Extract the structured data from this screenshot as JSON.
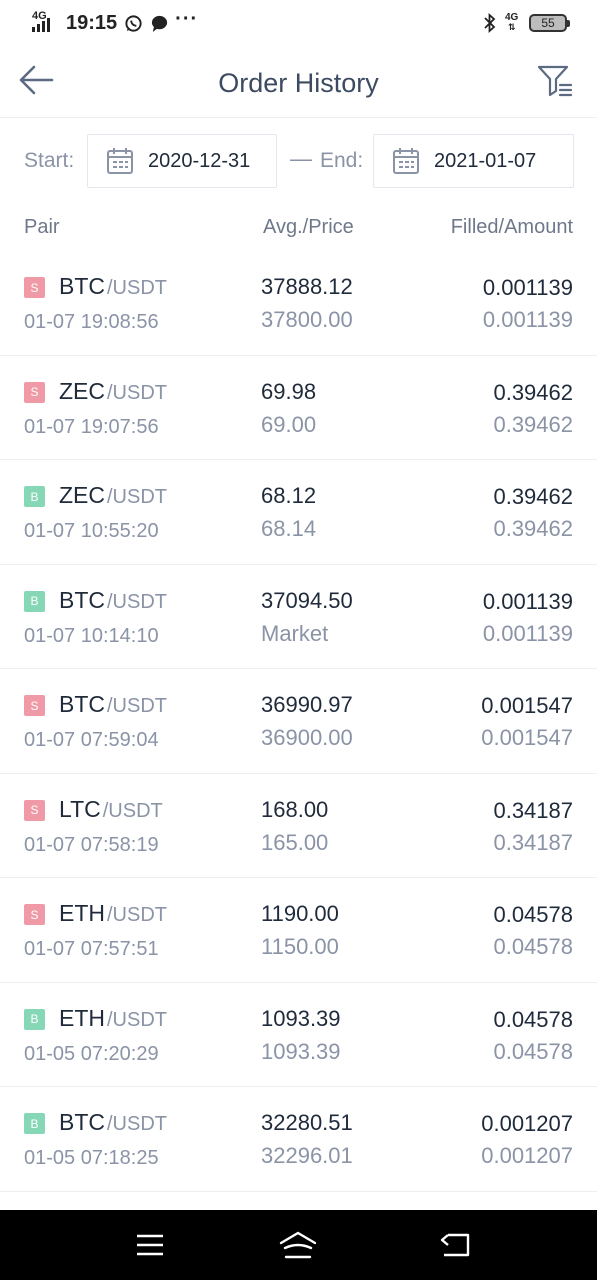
{
  "status_bar": {
    "network": "4G",
    "time": "19:15",
    "network_right": "4G",
    "battery": "55"
  },
  "header": {
    "title": "Order History"
  },
  "date_filter": {
    "start_label": "Start:",
    "start_value": "2020-12-31",
    "separator": "—",
    "end_label": "End:",
    "end_value": "2021-01-07"
  },
  "columns": {
    "pair": "Pair",
    "avg_price": "Avg./Price",
    "filled_amount": "Filled/Amount"
  },
  "orders": [
    {
      "side": "S",
      "base": "BTC",
      "quote": "/USDT",
      "time": "01-07 19:08:56",
      "avg": "37888.12",
      "price": "37800.00",
      "filled": "0.001139",
      "amount": "0.001139"
    },
    {
      "side": "S",
      "base": "ZEC",
      "quote": "/USDT",
      "time": "01-07 19:07:56",
      "avg": "69.98",
      "price": "69.00",
      "filled": "0.39462",
      "amount": "0.39462"
    },
    {
      "side": "B",
      "base": "ZEC",
      "quote": "/USDT",
      "time": "01-07 10:55:20",
      "avg": "68.12",
      "price": "68.14",
      "filled": "0.39462",
      "amount": "0.39462"
    },
    {
      "side": "B",
      "base": "BTC",
      "quote": "/USDT",
      "time": "01-07 10:14:10",
      "avg": "37094.50",
      "price": "Market",
      "filled": "0.001139",
      "amount": "0.001139"
    },
    {
      "side": "S",
      "base": "BTC",
      "quote": "/USDT",
      "time": "01-07 07:59:04",
      "avg": "36990.97",
      "price": "36900.00",
      "filled": "0.001547",
      "amount": "0.001547"
    },
    {
      "side": "S",
      "base": "LTC",
      "quote": "/USDT",
      "time": "01-07 07:58:19",
      "avg": "168.00",
      "price": "165.00",
      "filled": "0.34187",
      "amount": "0.34187"
    },
    {
      "side": "S",
      "base": "ETH",
      "quote": "/USDT",
      "time": "01-07 07:57:51",
      "avg": "1190.00",
      "price": "1150.00",
      "filled": "0.04578",
      "amount": "0.04578"
    },
    {
      "side": "B",
      "base": "ETH",
      "quote": "/USDT",
      "time": "01-05 07:20:29",
      "avg": "1093.39",
      "price": "1093.39",
      "filled": "0.04578",
      "amount": "0.04578"
    },
    {
      "side": "B",
      "base": "BTC",
      "quote": "/USDT",
      "time": "01-05 07:18:25",
      "avg": "32280.51",
      "price": "32296.01",
      "filled": "0.001207",
      "amount": "0.001207"
    }
  ],
  "colors": {
    "sell_badge": "#f19aa7",
    "buy_badge": "#86d7b6",
    "title_text": "#3d4b62",
    "muted_text": "#8b93a6"
  },
  "icons": [
    "back-arrow-icon",
    "filter-icon",
    "calendar-icon",
    "whatsapp-icon",
    "message-icon",
    "bluetooth-icon",
    "menu-icon",
    "home-icon",
    "back-icon"
  ]
}
